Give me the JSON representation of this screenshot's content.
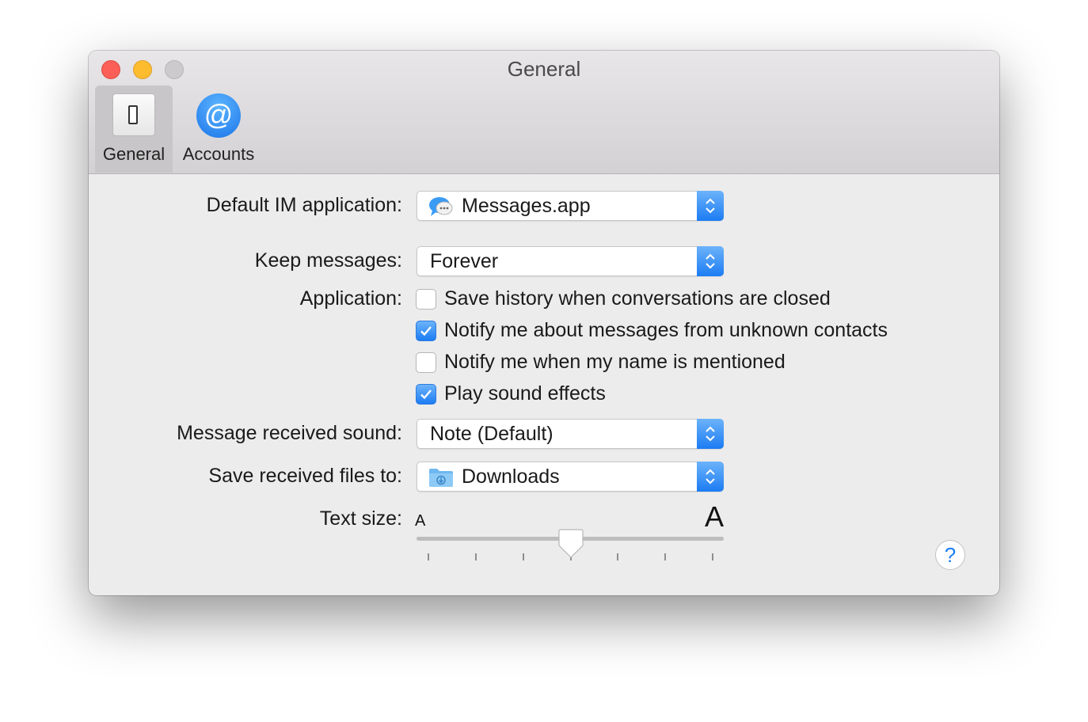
{
  "window": {
    "title": "General"
  },
  "toolbar": {
    "tabs": [
      {
        "label": "General",
        "icon": "switch-icon",
        "selected": true
      },
      {
        "label": "Accounts",
        "icon": "at-icon",
        "at_glyph": "@",
        "selected": false
      }
    ]
  },
  "form": {
    "default_im": {
      "label": "Default IM application:",
      "value": "Messages.app",
      "icon": "messages-app-icon"
    },
    "keep_messages": {
      "label": "Keep messages:",
      "value": "Forever"
    },
    "application": {
      "label": "Application:",
      "options": [
        {
          "label": "Save history when conversations are closed",
          "checked": false
        },
        {
          "label": "Notify me about messages from unknown contacts",
          "checked": true
        },
        {
          "label": "Notify me when my name is mentioned",
          "checked": false
        },
        {
          "label": "Play sound effects",
          "checked": true
        }
      ]
    },
    "received_sound": {
      "label": "Message received sound:",
      "value": "Note (Default)"
    },
    "save_files": {
      "label": "Save received files to:",
      "value": "Downloads",
      "icon": "downloads-folder-icon"
    },
    "text_size": {
      "label": "Text size:",
      "small_glyph": "A",
      "large_glyph": "A",
      "tick_count": 7,
      "level": 0.5
    }
  },
  "help": {
    "glyph": "?"
  },
  "colors": {
    "accent": "#1c7cf3",
    "close": "#fc5f57",
    "minimize": "#fdbc2e",
    "zoom": "#cccacc"
  }
}
